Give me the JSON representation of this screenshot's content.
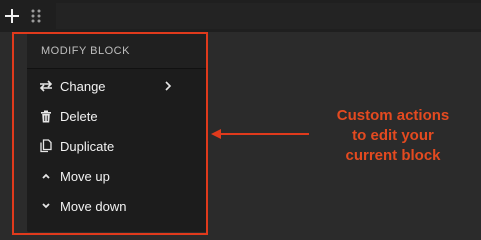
{
  "popover": {
    "title": "MODIFY BLOCK",
    "items": [
      {
        "label": "Change",
        "icon": "swap-arrows-icon",
        "has_submenu": true
      },
      {
        "label": "Delete",
        "icon": "trash-icon"
      },
      {
        "label": "Duplicate",
        "icon": "copy-icon"
      },
      {
        "label": "Move up",
        "icon": "chevron-up-icon"
      },
      {
        "label": "Move down",
        "icon": "chevron-down-icon"
      }
    ]
  },
  "annotation": {
    "text": "Custom actions\nto edit your\ncurrent block",
    "color": "#e44a20"
  },
  "colors": {
    "background": "#2b2b2b",
    "menu_bg": "#1c1c1c",
    "highlight_border": "#e03a1c"
  }
}
